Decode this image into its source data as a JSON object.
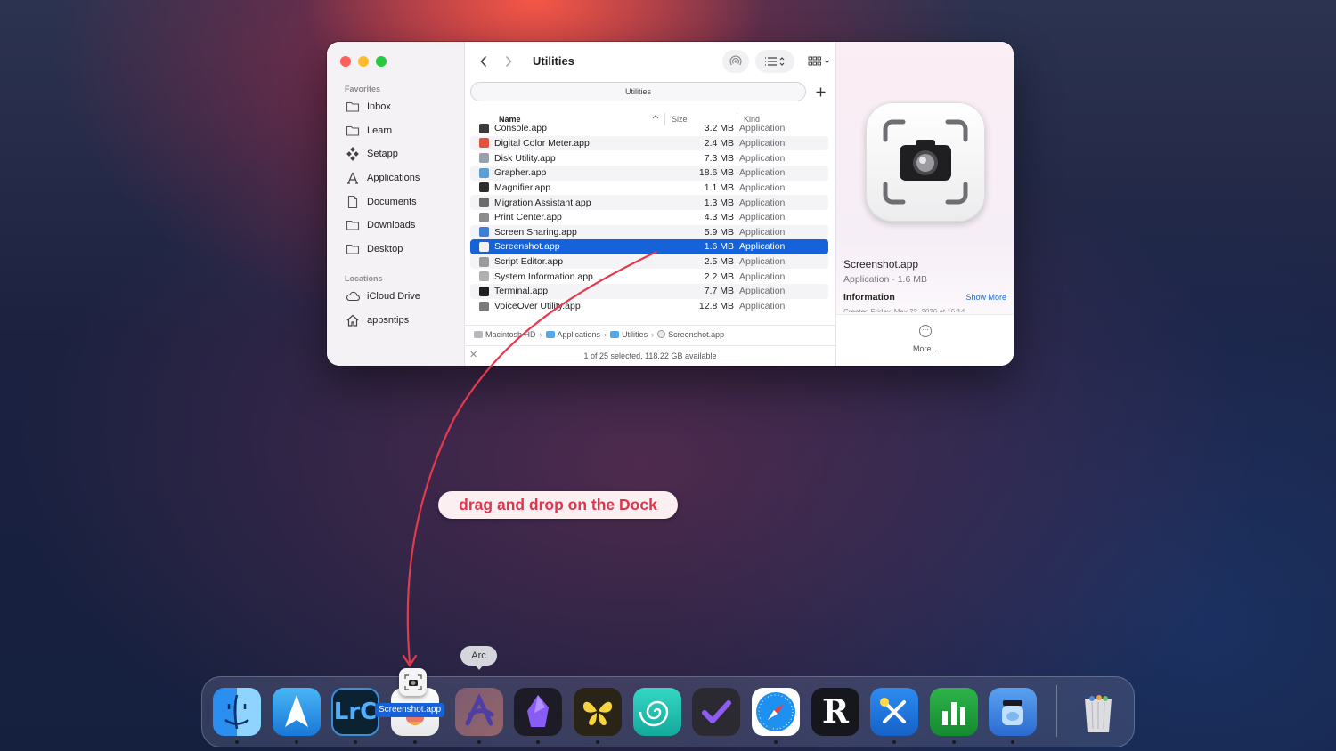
{
  "finder": {
    "title": "Utilities",
    "tab_label": "Utilities",
    "sidebar": {
      "favorites_header": "Favorites",
      "favorites": [
        {
          "label": "Inbox",
          "icon": "folder-icon"
        },
        {
          "label": "Learn",
          "icon": "folder-icon"
        },
        {
          "label": "Setapp",
          "icon": "setapp-icon"
        },
        {
          "label": "Applications",
          "icon": "applications-icon"
        },
        {
          "label": "Documents",
          "icon": "document-icon"
        },
        {
          "label": "Downloads",
          "icon": "folder-icon"
        },
        {
          "label": "Desktop",
          "icon": "folder-icon"
        }
      ],
      "locations_header": "Locations",
      "locations": [
        {
          "label": "iCloud Drive",
          "icon": "cloud-icon"
        },
        {
          "label": "appsntips",
          "icon": "home-icon"
        }
      ]
    },
    "columns": {
      "name": "Name",
      "size": "Size",
      "kind": "Kind"
    },
    "files": [
      {
        "name": "Console.app",
        "size": "3.2 MB",
        "kind": "Application",
        "color": "#3a3a3a"
      },
      {
        "name": "Digital Color Meter.app",
        "size": "2.4 MB",
        "kind": "Application",
        "color": "#e0533c"
      },
      {
        "name": "Disk Utility.app",
        "size": "7.3 MB",
        "kind": "Application",
        "color": "#9aa0a8"
      },
      {
        "name": "Grapher.app",
        "size": "18.6 MB",
        "kind": "Application",
        "color": "#5aa0d8"
      },
      {
        "name": "Magnifier.app",
        "size": "1.1 MB",
        "kind": "Application",
        "color": "#2b2b2b"
      },
      {
        "name": "Migration Assistant.app",
        "size": "1.3 MB",
        "kind": "Application",
        "color": "#6a6a6e"
      },
      {
        "name": "Print Center.app",
        "size": "4.3 MB",
        "kind": "Application",
        "color": "#8c8c90"
      },
      {
        "name": "Screen Sharing.app",
        "size": "5.9 MB",
        "kind": "Application",
        "color": "#3d7fd0"
      },
      {
        "name": "Screenshot.app",
        "size": "1.6 MB",
        "kind": "Application",
        "color": "#f2f2f2"
      },
      {
        "name": "Script Editor.app",
        "size": "2.5 MB",
        "kind": "Application",
        "color": "#9a9a9a"
      },
      {
        "name": "System Information.app",
        "size": "2.2 MB",
        "kind": "Application",
        "color": "#b0b0b4"
      },
      {
        "name": "Terminal.app",
        "size": "7.7 MB",
        "kind": "Application",
        "color": "#1e1e1e"
      },
      {
        "name": "VoiceOver Utility.app",
        "size": "12.8 MB",
        "kind": "Application",
        "color": "#7a7a7e"
      }
    ],
    "path": [
      "Macintosh HD",
      "Applications",
      "Utilities",
      "Screenshot.app"
    ],
    "status": "1 of 25 selected, 118.22 GB available",
    "preview": {
      "name": "Screenshot.app",
      "subtitle": "Application - 1.6 MB",
      "info_header": "Information",
      "show_more": "Show More",
      "created": "Created        Friday, May 22, 2026 at 16:14",
      "more": "More..."
    }
  },
  "annotation": {
    "text": "drag and drop on the Dock",
    "color": "#e0364b"
  },
  "dock": {
    "tooltip": "Arc",
    "drag_label": "Screenshot.app",
    "apps": [
      {
        "name": "Finder",
        "icon": "finder-icon"
      },
      {
        "name": "Spark",
        "icon": "spark-icon"
      },
      {
        "name": "Lightroom Classic",
        "icon": "lightroom-icon",
        "text": "LrC"
      },
      {
        "name": "Screenshot",
        "icon": "screenshot-icon"
      },
      {
        "name": "Arc",
        "icon": "arc-icon"
      },
      {
        "name": "Obsidian",
        "icon": "obsidian-icon"
      },
      {
        "name": "Tes",
        "icon": "butterfly-icon"
      },
      {
        "name": "Perplexity",
        "icon": "spiral-icon"
      },
      {
        "name": "OmniFocus",
        "icon": "checkmark-icon"
      },
      {
        "name": "Safari",
        "icon": "safari-icon"
      },
      {
        "name": "Reeder",
        "icon": "reeder-icon",
        "text": "R"
      },
      {
        "name": "Xcode Tools",
        "icon": "tools-icon"
      },
      {
        "name": "Numbers",
        "icon": "numbers-icon"
      },
      {
        "name": "Backup",
        "icon": "jar-icon"
      },
      {
        "name": "Trash",
        "icon": "trash-icon"
      }
    ]
  }
}
